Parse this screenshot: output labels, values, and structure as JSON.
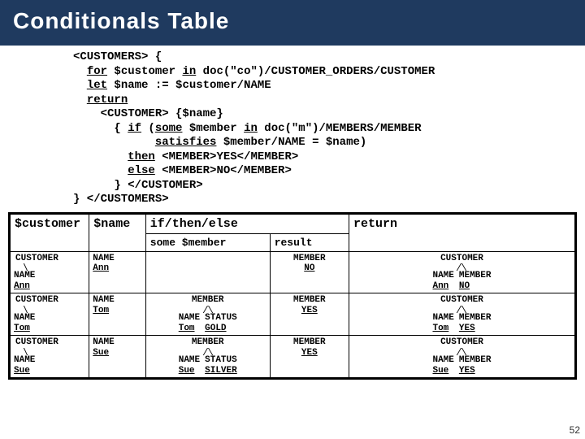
{
  "header": {
    "title": "Conditionals Table"
  },
  "code": {
    "lines_html": "<span>&lt;CUSTOMERS&gt; {</span>\n  <span class=\"u\">for</span> $customer <span class=\"u\">in</span> doc(\"co\")/CUSTOMER_ORDERS/CUSTOMER\n  <span class=\"u\">let</span> $name := $customer/NAME\n  <span class=\"u\">return</span>\n    &lt;CUSTOMER&gt; {$name}\n      { <span class=\"u\">if</span> (<span class=\"u\">some</span> $member <span class=\"u\">in</span> doc(\"m\")/MEMBERS/MEMBER\n            <span class=\"u\">satisfies</span> $member/NAME = $name)\n        <span class=\"u\">then</span> &lt;MEMBER&gt;YES&lt;/MEMBER&gt;\n        <span class=\"u\">else</span> &lt;MEMBER&gt;NO&lt;/MEMBER&gt;\n      } &lt;/CUSTOMER&gt;\n} &lt;/CUSTOMERS&gt;"
  },
  "table": {
    "headers": {
      "c1": "$customer",
      "c2": "$name",
      "c3": "if/then/else",
      "c3a": "some $member",
      "c3b": "result",
      "c4": "return"
    },
    "rows": [
      {
        "customer_root": "CUSTOMER",
        "customer_name_label": "NAME",
        "customer_name_value": "Ann",
        "name_label": "NAME",
        "name_value": "Ann",
        "some_member": "",
        "result_root": "MEMBER",
        "result_value": "NO",
        "return_root": "CUSTOMER",
        "return_left_label": "NAME",
        "return_left_value": "Ann",
        "return_right_label": "MEMBER",
        "return_right_value": "NO"
      },
      {
        "customer_root": "CUSTOMER",
        "customer_name_label": "NAME",
        "customer_name_value": "Tom",
        "name_label": "NAME",
        "name_value": "Tom",
        "some_member_root": "MEMBER",
        "some_left_label": "NAME",
        "some_left_value": "Tom",
        "some_right_label": "STATUS",
        "some_right_value": "GOLD",
        "result_root": "MEMBER",
        "result_value": "YES",
        "return_root": "CUSTOMER",
        "return_left_label": "NAME",
        "return_left_value": "Tom",
        "return_right_label": "MEMBER",
        "return_right_value": "YES"
      },
      {
        "customer_root": "CUSTOMER",
        "customer_name_label": "NAME",
        "customer_name_value": "Sue",
        "name_label": "NAME",
        "name_value": "Sue",
        "some_member_root": "MEMBER",
        "some_left_label": "NAME",
        "some_left_value": "Sue",
        "some_right_label": "STATUS",
        "some_right_value": "SILVER",
        "result_root": "MEMBER",
        "result_value": "YES",
        "return_root": "CUSTOMER",
        "return_left_label": "NAME",
        "return_left_value": "Sue",
        "return_right_label": "MEMBER",
        "return_right_value": "YES"
      }
    ]
  },
  "page": "52"
}
